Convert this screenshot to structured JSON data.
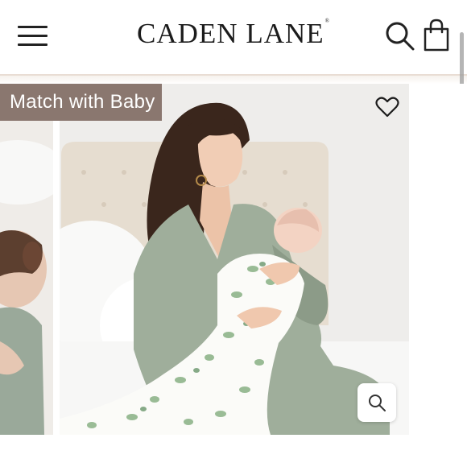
{
  "header": {
    "brand": "CADEN LANE",
    "brand_mark": "®",
    "menu_icon": "hamburger-menu-icon",
    "search_icon": "search-icon",
    "cart_icon": "shopping-bag-icon"
  },
  "product": {
    "badge_label": "Match with Baby",
    "wishlist_icon": "heart-outline-icon",
    "zoom_icon": "zoom-magnifier-icon",
    "images": [
      "baby in sage green outfit (previous slide)",
      "mother in sage green robe holding newborn wrapped in eucalyptus print blanket",
      "next slide (blank)"
    ]
  },
  "colors": {
    "badge_bg": "#8a776f",
    "text_dark": "#1c1c1c",
    "robe_sage": "#9fae9b",
    "divider": "#e9ddd4"
  }
}
